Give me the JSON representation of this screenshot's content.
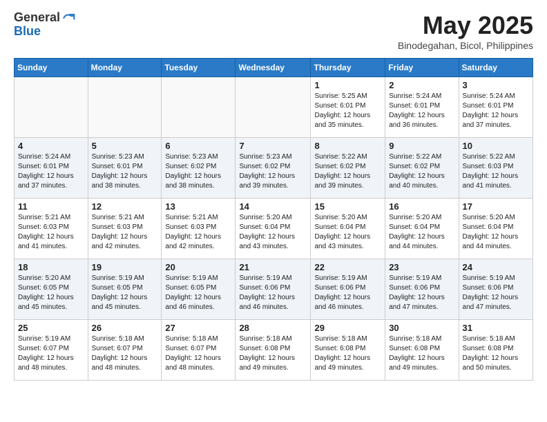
{
  "header": {
    "logo_line1": "General",
    "logo_line2": "Blue",
    "month": "May 2025",
    "location": "Binodegahan, Bicol, Philippines"
  },
  "weekdays": [
    "Sunday",
    "Monday",
    "Tuesday",
    "Wednesday",
    "Thursday",
    "Friday",
    "Saturday"
  ],
  "weeks": [
    [
      {
        "day": "",
        "info": ""
      },
      {
        "day": "",
        "info": ""
      },
      {
        "day": "",
        "info": ""
      },
      {
        "day": "",
        "info": ""
      },
      {
        "day": "1",
        "info": "Sunrise: 5:25 AM\nSunset: 6:01 PM\nDaylight: 12 hours\nand 35 minutes."
      },
      {
        "day": "2",
        "info": "Sunrise: 5:24 AM\nSunset: 6:01 PM\nDaylight: 12 hours\nand 36 minutes."
      },
      {
        "day": "3",
        "info": "Sunrise: 5:24 AM\nSunset: 6:01 PM\nDaylight: 12 hours\nand 37 minutes."
      }
    ],
    [
      {
        "day": "4",
        "info": "Sunrise: 5:24 AM\nSunset: 6:01 PM\nDaylight: 12 hours\nand 37 minutes."
      },
      {
        "day": "5",
        "info": "Sunrise: 5:23 AM\nSunset: 6:01 PM\nDaylight: 12 hours\nand 38 minutes."
      },
      {
        "day": "6",
        "info": "Sunrise: 5:23 AM\nSunset: 6:02 PM\nDaylight: 12 hours\nand 38 minutes."
      },
      {
        "day": "7",
        "info": "Sunrise: 5:23 AM\nSunset: 6:02 PM\nDaylight: 12 hours\nand 39 minutes."
      },
      {
        "day": "8",
        "info": "Sunrise: 5:22 AM\nSunset: 6:02 PM\nDaylight: 12 hours\nand 39 minutes."
      },
      {
        "day": "9",
        "info": "Sunrise: 5:22 AM\nSunset: 6:02 PM\nDaylight: 12 hours\nand 40 minutes."
      },
      {
        "day": "10",
        "info": "Sunrise: 5:22 AM\nSunset: 6:03 PM\nDaylight: 12 hours\nand 41 minutes."
      }
    ],
    [
      {
        "day": "11",
        "info": "Sunrise: 5:21 AM\nSunset: 6:03 PM\nDaylight: 12 hours\nand 41 minutes."
      },
      {
        "day": "12",
        "info": "Sunrise: 5:21 AM\nSunset: 6:03 PM\nDaylight: 12 hours\nand 42 minutes."
      },
      {
        "day": "13",
        "info": "Sunrise: 5:21 AM\nSunset: 6:03 PM\nDaylight: 12 hours\nand 42 minutes."
      },
      {
        "day": "14",
        "info": "Sunrise: 5:20 AM\nSunset: 6:04 PM\nDaylight: 12 hours\nand 43 minutes."
      },
      {
        "day": "15",
        "info": "Sunrise: 5:20 AM\nSunset: 6:04 PM\nDaylight: 12 hours\nand 43 minutes."
      },
      {
        "day": "16",
        "info": "Sunrise: 5:20 AM\nSunset: 6:04 PM\nDaylight: 12 hours\nand 44 minutes."
      },
      {
        "day": "17",
        "info": "Sunrise: 5:20 AM\nSunset: 6:04 PM\nDaylight: 12 hours\nand 44 minutes."
      }
    ],
    [
      {
        "day": "18",
        "info": "Sunrise: 5:20 AM\nSunset: 6:05 PM\nDaylight: 12 hours\nand 45 minutes."
      },
      {
        "day": "19",
        "info": "Sunrise: 5:19 AM\nSunset: 6:05 PM\nDaylight: 12 hours\nand 45 minutes."
      },
      {
        "day": "20",
        "info": "Sunrise: 5:19 AM\nSunset: 6:05 PM\nDaylight: 12 hours\nand 46 minutes."
      },
      {
        "day": "21",
        "info": "Sunrise: 5:19 AM\nSunset: 6:06 PM\nDaylight: 12 hours\nand 46 minutes."
      },
      {
        "day": "22",
        "info": "Sunrise: 5:19 AM\nSunset: 6:06 PM\nDaylight: 12 hours\nand 46 minutes."
      },
      {
        "day": "23",
        "info": "Sunrise: 5:19 AM\nSunset: 6:06 PM\nDaylight: 12 hours\nand 47 minutes."
      },
      {
        "day": "24",
        "info": "Sunrise: 5:19 AM\nSunset: 6:06 PM\nDaylight: 12 hours\nand 47 minutes."
      }
    ],
    [
      {
        "day": "25",
        "info": "Sunrise: 5:19 AM\nSunset: 6:07 PM\nDaylight: 12 hours\nand 48 minutes."
      },
      {
        "day": "26",
        "info": "Sunrise: 5:18 AM\nSunset: 6:07 PM\nDaylight: 12 hours\nand 48 minutes."
      },
      {
        "day": "27",
        "info": "Sunrise: 5:18 AM\nSunset: 6:07 PM\nDaylight: 12 hours\nand 48 minutes."
      },
      {
        "day": "28",
        "info": "Sunrise: 5:18 AM\nSunset: 6:08 PM\nDaylight: 12 hours\nand 49 minutes."
      },
      {
        "day": "29",
        "info": "Sunrise: 5:18 AM\nSunset: 6:08 PM\nDaylight: 12 hours\nand 49 minutes."
      },
      {
        "day": "30",
        "info": "Sunrise: 5:18 AM\nSunset: 6:08 PM\nDaylight: 12 hours\nand 49 minutes."
      },
      {
        "day": "31",
        "info": "Sunrise: 5:18 AM\nSunset: 6:08 PM\nDaylight: 12 hours\nand 50 minutes."
      }
    ]
  ]
}
